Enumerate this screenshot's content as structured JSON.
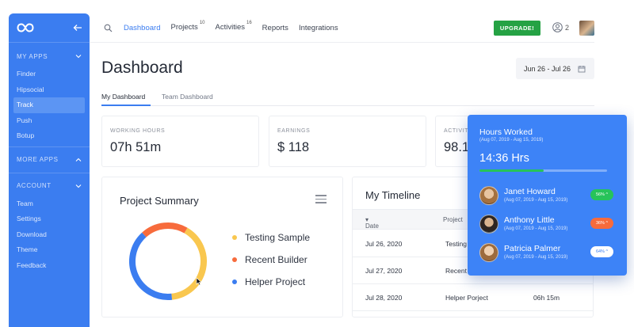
{
  "sidebar": {
    "logo": "infinity-logo",
    "sections": [
      {
        "title": "MY APPS",
        "items": [
          "Finder",
          "Hipsocial",
          "Track",
          "Push",
          "Botup"
        ],
        "active": "Track"
      },
      {
        "title": "MORE APPS",
        "items": []
      },
      {
        "title": "ACCOUNT",
        "items": [
          "Team",
          "Settings",
          "Download",
          "Theme",
          "Feedback"
        ]
      }
    ]
  },
  "topbar": {
    "nav": [
      {
        "label": "Dashboard",
        "badge": ""
      },
      {
        "label": "Projects",
        "badge": "10"
      },
      {
        "label": "Activities",
        "badge": "16"
      },
      {
        "label": "Reports",
        "badge": ""
      },
      {
        "label": "Integrations",
        "badge": ""
      }
    ],
    "upgrade_label": "UPGRADE!",
    "user_count": "2"
  },
  "page": {
    "title": "Dashboard",
    "date_range": "Jun 26 - Jul 26",
    "tabs": [
      "My Dashboard",
      "Team Dashboard"
    ]
  },
  "stats": [
    {
      "label": "WORKING HOURS",
      "value": "07h 51m"
    },
    {
      "label": "EARNINGS",
      "value": "$ 118"
    },
    {
      "label": "ACTIVITY",
      "value": "98.1"
    }
  ],
  "project_summary": {
    "title": "Project Summary",
    "legend": [
      {
        "label": "Testing Sample",
        "color": "#f9c74f"
      },
      {
        "label": "Recent Builder",
        "color": "#f76b3c"
      },
      {
        "label": "Helper Project",
        "color": "#3b7df0"
      }
    ],
    "chart_data": {
      "type": "pie",
      "categories": [
        "Testing Sample",
        "Recent Builder",
        "Helper Project"
      ],
      "values": [
        40,
        20,
        40
      ]
    }
  },
  "timeline": {
    "title": "My Timeline",
    "columns": [
      "Date",
      "Project"
    ],
    "rows": [
      {
        "date": "Jul 26, 2020",
        "project": "Testing",
        "time": ""
      },
      {
        "date": "Jul 27, 2020",
        "project": "Recent",
        "time": ""
      },
      {
        "date": "Jul 28, 2020",
        "project": "Helper Porject",
        "time": "06h 15m"
      }
    ]
  },
  "hours_worked": {
    "title": "Hours Worked",
    "period": "(Aug 07, 2019 - Aug 15, 2019)",
    "value": "14:36 Hrs",
    "progress": 0.5,
    "people": [
      {
        "name": "Janet Howard",
        "period": "(Aug 07, 2019 - Aug 15, 2019)",
        "badge": "56% ^",
        "badge_color": "#27c35a",
        "badge_text_color": "#ffffff"
      },
      {
        "name": "Anthony Little",
        "period": "(Aug 07, 2019 - Aug 15, 2019)",
        "badge": "36% ^",
        "badge_color": "#f76b3c",
        "badge_text_color": "#ffffff"
      },
      {
        "name": "Patricia Palmer",
        "period": "(Aug 07, 2019 - Aug 15, 2019)",
        "badge": "64% ^",
        "badge_color": "#ffffff",
        "badge_text_color": "#3b7df0"
      }
    ]
  }
}
